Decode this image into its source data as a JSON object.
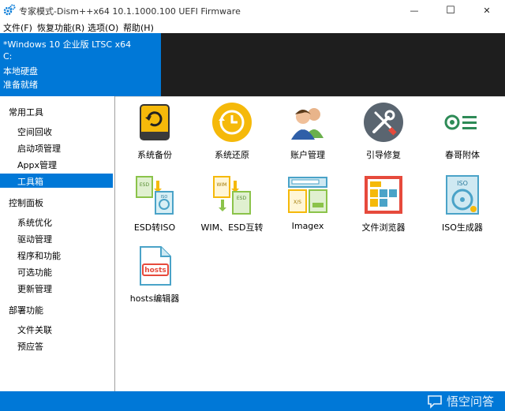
{
  "window": {
    "title": "专家模式-Dism++x64 10.1.1000.100 UEFI Firmware",
    "minimize": "—",
    "maximize": "☐",
    "close": "✕"
  },
  "menu": [
    "文件(F)",
    "恢复功能(R)",
    "选项(O)",
    "帮助(H)"
  ],
  "info": {
    "os": "*Windows 10 企业版 LTSC x64",
    "drive": "C:",
    "disk": "本地硬盘",
    "status": "准备就绪"
  },
  "sidebar": {
    "groups": [
      {
        "label": "常用工具",
        "items": [
          "空间回收",
          "启动项管理",
          "Appx管理",
          "工具箱"
        ]
      },
      {
        "label": "控制面板",
        "items": [
          "系统优化",
          "驱动管理",
          "程序和功能",
          "可选功能",
          "更新管理"
        ]
      },
      {
        "label": "部署功能",
        "items": [
          "文件关联",
          "预应答"
        ]
      }
    ],
    "active": "工具箱"
  },
  "tools": [
    {
      "label": "系统备份",
      "icon": "backup-drive-icon"
    },
    {
      "label": "系统还原",
      "icon": "restore-clock-icon"
    },
    {
      "label": "账户管理",
      "icon": "users-icon"
    },
    {
      "label": "引导修复",
      "icon": "tools-wrench-icon"
    },
    {
      "label": "春哥附体",
      "icon": "toggle-settings-icon"
    },
    {
      "label": "ESD转ISO",
      "icon": "esd-to-iso-icon"
    },
    {
      "label": "WIM、ESD互转",
      "icon": "wim-esd-convert-icon"
    },
    {
      "label": "Imagex",
      "icon": "imagex-icon"
    },
    {
      "label": "文件浏览器",
      "icon": "file-browser-icon"
    },
    {
      "label": "ISO生成器",
      "icon": "iso-disc-icon"
    },
    {
      "label": "hosts编辑器",
      "icon": "hosts-file-icon"
    }
  ],
  "icon_text": {
    "esd": "ESD",
    "iso": "ISO",
    "wim": "WIM",
    "hosts": "hosts",
    "xs": "X/S"
  },
  "watermark": "悟空问答",
  "colors": {
    "accent": "#0078d7",
    "dark_bar": "#1e1e1e",
    "gold": "#f5b90a",
    "green": "#2e8b57"
  }
}
